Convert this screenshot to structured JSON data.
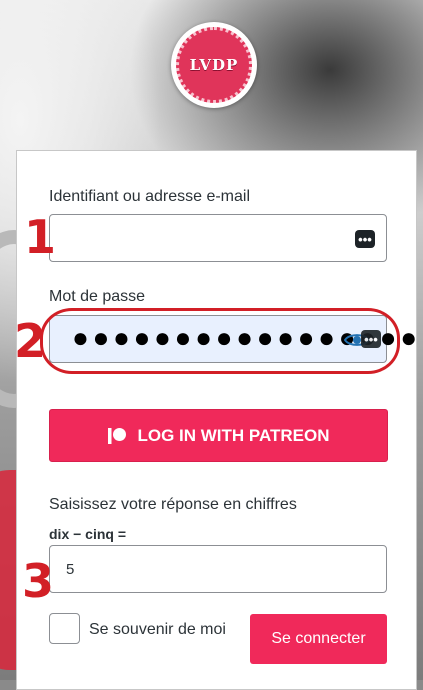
{
  "logo": {
    "text": "LVDP"
  },
  "username": {
    "label": "Identifiant ou adresse e-mail",
    "value": ""
  },
  "password": {
    "label": "Mot de passe",
    "mask": "●●●●●●●●●●●●●●●●●"
  },
  "keepass_icon_glyph": "•••",
  "patreon": {
    "label": "LOG IN WITH PATREON"
  },
  "captcha": {
    "prompt": "Saisissez votre réponse en chiffres",
    "expression": "dix − cinq =",
    "value": "5"
  },
  "remember": {
    "label": "Se souvenir de moi"
  },
  "submit": {
    "label": "Se connecter"
  },
  "annotations": [
    "1",
    "2",
    "3"
  ],
  "colors": {
    "accent": "#f0295a",
    "annotation": "#d21f26",
    "autofill": "#e8f0fe"
  }
}
